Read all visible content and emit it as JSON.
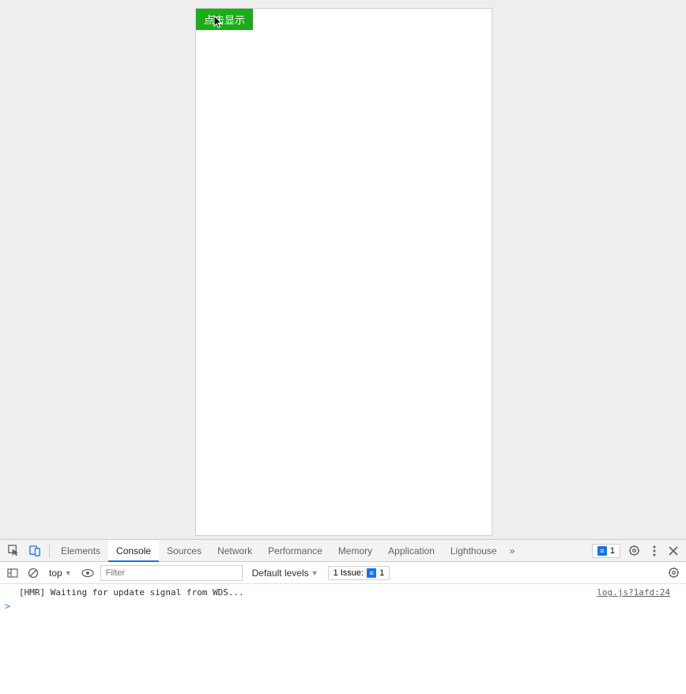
{
  "app": {
    "button_label": "点击显示"
  },
  "devtools": {
    "tabs": [
      "Elements",
      "Console",
      "Sources",
      "Network",
      "Performance",
      "Memory",
      "Application",
      "Lighthouse"
    ],
    "active_tab": "Console",
    "issues_badge_count": "1",
    "console_toolbar": {
      "context": "top",
      "filter_placeholder": "Filter",
      "levels_label": "Default levels",
      "issue_label": "1 Issue:",
      "issue_count": "1"
    },
    "console": {
      "messages": [
        {
          "text": "[HMR] Waiting for update signal from WDS...",
          "source": "log.js?1afd:24"
        }
      ],
      "prompt": ">"
    }
  }
}
